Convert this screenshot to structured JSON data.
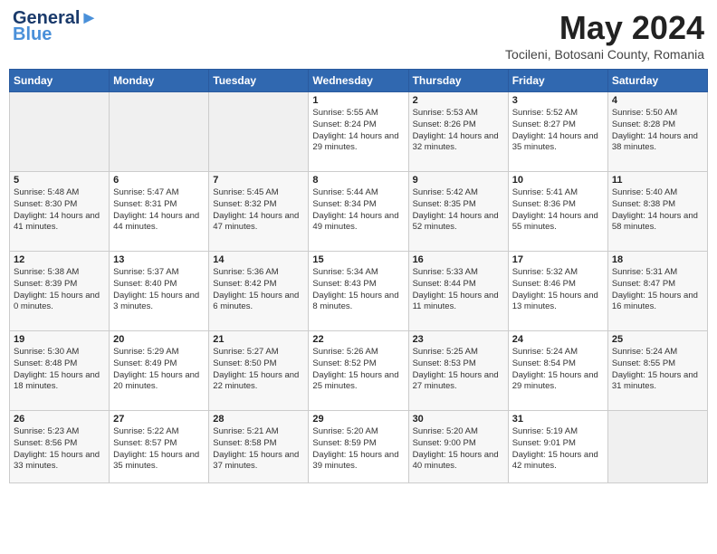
{
  "header": {
    "logo_line1": "General",
    "logo_line2": "Blue",
    "month": "May 2024",
    "location": "Tocileni, Botosani County, Romania"
  },
  "days_of_week": [
    "Sunday",
    "Monday",
    "Tuesday",
    "Wednesday",
    "Thursday",
    "Friday",
    "Saturday"
  ],
  "weeks": [
    [
      {
        "day": "",
        "empty": true
      },
      {
        "day": "",
        "empty": true
      },
      {
        "day": "",
        "empty": true
      },
      {
        "day": "1",
        "sunrise": "5:55 AM",
        "sunset": "8:24 PM",
        "daylight": "14 hours and 29 minutes."
      },
      {
        "day": "2",
        "sunrise": "5:53 AM",
        "sunset": "8:26 PM",
        "daylight": "14 hours and 32 minutes."
      },
      {
        "day": "3",
        "sunrise": "5:52 AM",
        "sunset": "8:27 PM",
        "daylight": "14 hours and 35 minutes."
      },
      {
        "day": "4",
        "sunrise": "5:50 AM",
        "sunset": "8:28 PM",
        "daylight": "14 hours and 38 minutes."
      }
    ],
    [
      {
        "day": "5",
        "sunrise": "5:48 AM",
        "sunset": "8:30 PM",
        "daylight": "14 hours and 41 minutes."
      },
      {
        "day": "6",
        "sunrise": "5:47 AM",
        "sunset": "8:31 PM",
        "daylight": "14 hours and 44 minutes."
      },
      {
        "day": "7",
        "sunrise": "5:45 AM",
        "sunset": "8:32 PM",
        "daylight": "14 hours and 47 minutes."
      },
      {
        "day": "8",
        "sunrise": "5:44 AM",
        "sunset": "8:34 PM",
        "daylight": "14 hours and 49 minutes."
      },
      {
        "day": "9",
        "sunrise": "5:42 AM",
        "sunset": "8:35 PM",
        "daylight": "14 hours and 52 minutes."
      },
      {
        "day": "10",
        "sunrise": "5:41 AM",
        "sunset": "8:36 PM",
        "daylight": "14 hours and 55 minutes."
      },
      {
        "day": "11",
        "sunrise": "5:40 AM",
        "sunset": "8:38 PM",
        "daylight": "14 hours and 58 minutes."
      }
    ],
    [
      {
        "day": "12",
        "sunrise": "5:38 AM",
        "sunset": "8:39 PM",
        "daylight": "15 hours and 0 minutes."
      },
      {
        "day": "13",
        "sunrise": "5:37 AM",
        "sunset": "8:40 PM",
        "daylight": "15 hours and 3 minutes."
      },
      {
        "day": "14",
        "sunrise": "5:36 AM",
        "sunset": "8:42 PM",
        "daylight": "15 hours and 6 minutes."
      },
      {
        "day": "15",
        "sunrise": "5:34 AM",
        "sunset": "8:43 PM",
        "daylight": "15 hours and 8 minutes."
      },
      {
        "day": "16",
        "sunrise": "5:33 AM",
        "sunset": "8:44 PM",
        "daylight": "15 hours and 11 minutes."
      },
      {
        "day": "17",
        "sunrise": "5:32 AM",
        "sunset": "8:46 PM",
        "daylight": "15 hours and 13 minutes."
      },
      {
        "day": "18",
        "sunrise": "5:31 AM",
        "sunset": "8:47 PM",
        "daylight": "15 hours and 16 minutes."
      }
    ],
    [
      {
        "day": "19",
        "sunrise": "5:30 AM",
        "sunset": "8:48 PM",
        "daylight": "15 hours and 18 minutes."
      },
      {
        "day": "20",
        "sunrise": "5:29 AM",
        "sunset": "8:49 PM",
        "daylight": "15 hours and 20 minutes."
      },
      {
        "day": "21",
        "sunrise": "5:27 AM",
        "sunset": "8:50 PM",
        "daylight": "15 hours and 22 minutes."
      },
      {
        "day": "22",
        "sunrise": "5:26 AM",
        "sunset": "8:52 PM",
        "daylight": "15 hours and 25 minutes."
      },
      {
        "day": "23",
        "sunrise": "5:25 AM",
        "sunset": "8:53 PM",
        "daylight": "15 hours and 27 minutes."
      },
      {
        "day": "24",
        "sunrise": "5:24 AM",
        "sunset": "8:54 PM",
        "daylight": "15 hours and 29 minutes."
      },
      {
        "day": "25",
        "sunrise": "5:24 AM",
        "sunset": "8:55 PM",
        "daylight": "15 hours and 31 minutes."
      }
    ],
    [
      {
        "day": "26",
        "sunrise": "5:23 AM",
        "sunset": "8:56 PM",
        "daylight": "15 hours and 33 minutes."
      },
      {
        "day": "27",
        "sunrise": "5:22 AM",
        "sunset": "8:57 PM",
        "daylight": "15 hours and 35 minutes."
      },
      {
        "day": "28",
        "sunrise": "5:21 AM",
        "sunset": "8:58 PM",
        "daylight": "15 hours and 37 minutes."
      },
      {
        "day": "29",
        "sunrise": "5:20 AM",
        "sunset": "8:59 PM",
        "daylight": "15 hours and 39 minutes."
      },
      {
        "day": "30",
        "sunrise": "5:20 AM",
        "sunset": "9:00 PM",
        "daylight": "15 hours and 40 minutes."
      },
      {
        "day": "31",
        "sunrise": "5:19 AM",
        "sunset": "9:01 PM",
        "daylight": "15 hours and 42 minutes."
      },
      {
        "day": "",
        "empty": true
      }
    ]
  ]
}
